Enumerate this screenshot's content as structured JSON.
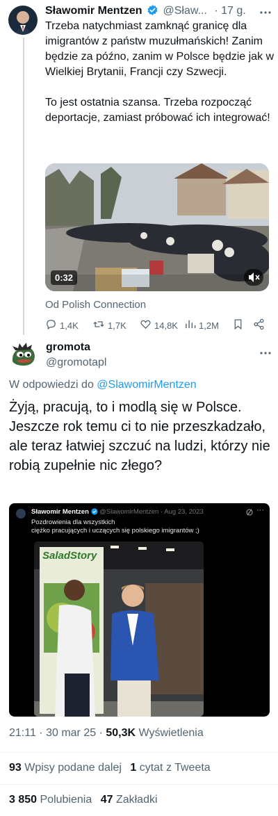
{
  "tweet1": {
    "author_name": "Sławomir Mentzen",
    "handle_truncated": "@Sław...",
    "time": "· 17 g.",
    "text": "Trzeba natychmiast zamknąć granicę dla imigrantów z państw muzułmańskich! Zanim będzie za późno, zanim w Polsce będzie jak w Wielkiej Brytanii, Francji czy Szwecji.\n\nTo jest ostatnia szansa. Trzeba rozpocząć deportacje, zamiast próbować ich integrować!",
    "video_duration": "0:32",
    "source": "Od Polish Connection",
    "replies": "1,4K",
    "retweets": "1,7K",
    "likes": "14,8K",
    "views": "1,2M"
  },
  "tweet2": {
    "author_name": "gromota",
    "handle": "@gromotapl",
    "reply_prefix": "W odpowiedzi do",
    "reply_to": "@SlawomirMentzen",
    "text": "Żyją, pracują, to i modlą się w Polsce. Jeszcze rok temu ci to nie przeszkadzało, ale teraz łatwiej szczuć na ludzi, którzy nie robią zupełnie nic złego?",
    "quote": {
      "author_name": "Sławomir Mentzen",
      "handle": "@SlawomirMentzen",
      "date": "· Aug 23, 2023",
      "text_line1": "Pozdrowienia dla wszystkich",
      "text_line2": "ciężko pracujących i uczących się polskiego imigrantów ;)",
      "sign_text": "SaladStory"
    },
    "timestamp": "21:11 · 30 mar 25 ·",
    "views_count": "50,3K",
    "views_label": "Wyświetlenia",
    "retweets_count": "93",
    "retweets_label": "Wpisy podane dalej",
    "quotes_count": "1",
    "quotes_label": "cytat z Tweeta",
    "likes_count": "3 850",
    "likes_label": "Polubienia",
    "bookmarks_count": "47",
    "bookmarks_label": "Zakładki"
  },
  "colors": {
    "accent": "#1d9bf0",
    "muted": "#536471",
    "divider": "#eff3f4"
  }
}
